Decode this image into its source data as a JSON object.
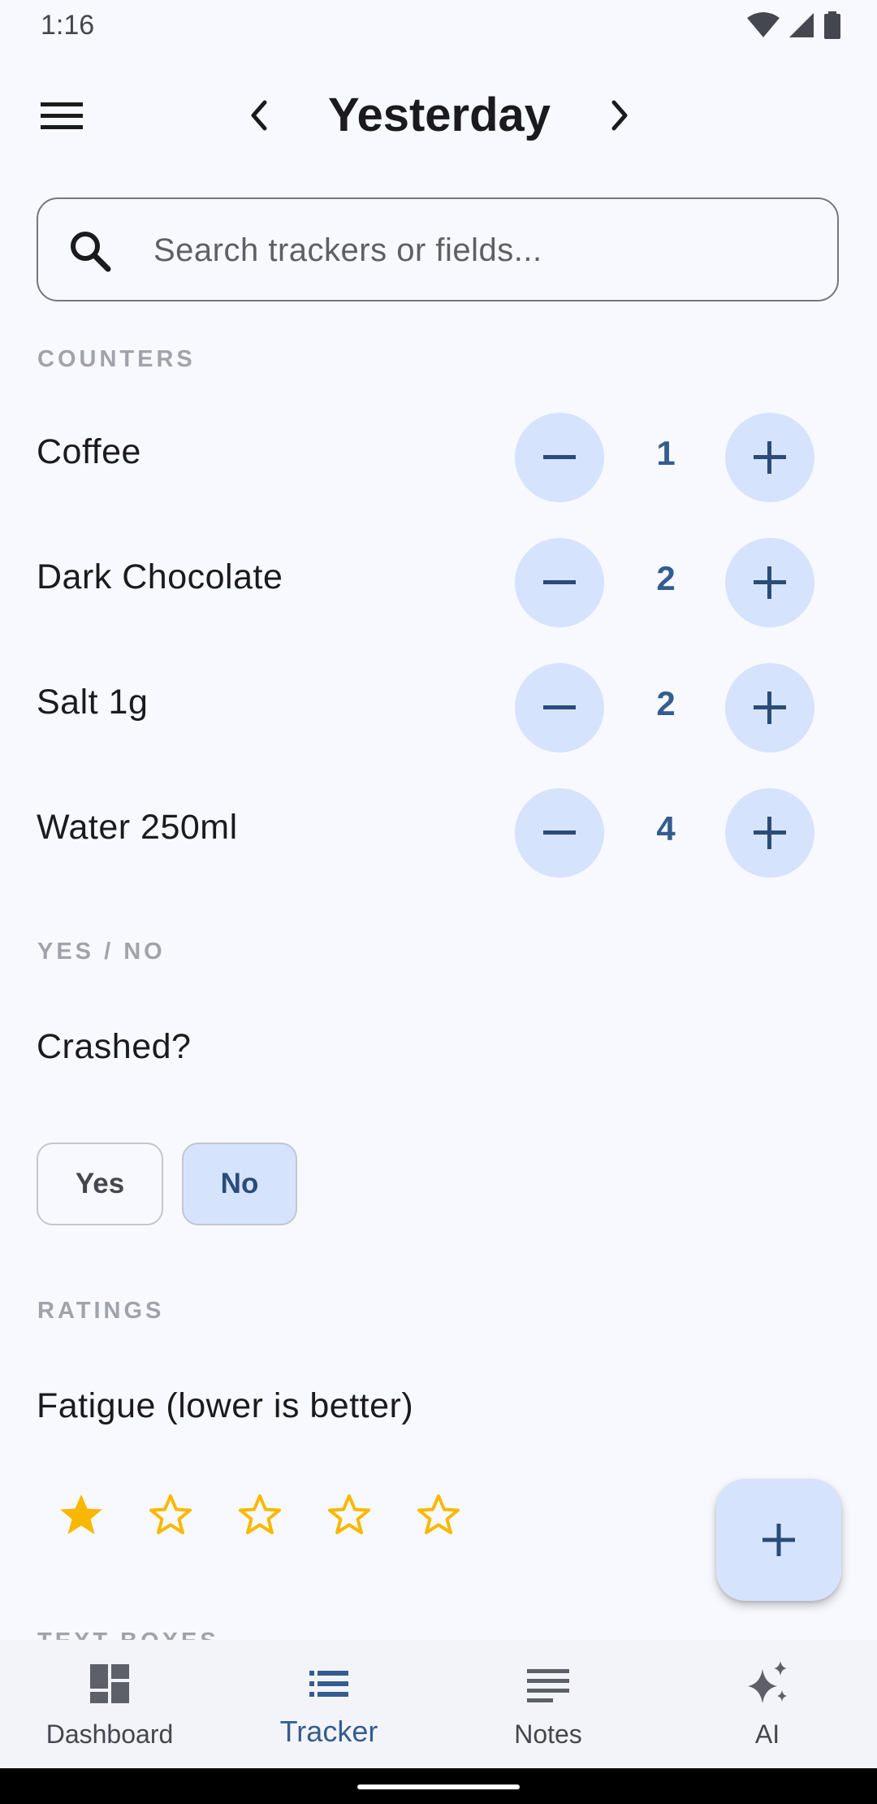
{
  "status_bar": {
    "time": "1:16"
  },
  "header": {
    "title": "Yesterday"
  },
  "search": {
    "placeholder": "Search trackers or fields..."
  },
  "sections": {
    "counters": "COUNTERS",
    "yes_no": "YES / NO",
    "ratings": "RATINGS",
    "text_boxes": "TEXT BOXES"
  },
  "counters": [
    {
      "label": "Coffee",
      "value": "1"
    },
    {
      "label": "Dark Chocolate",
      "value": "2"
    },
    {
      "label": "Salt 1g",
      "value": "2"
    },
    {
      "label": "Water 250ml",
      "value": "4"
    }
  ],
  "yes_no": {
    "question": "Crashed?",
    "yes_label": "Yes",
    "no_label": "No",
    "selected": "No"
  },
  "rating": {
    "label": "Fatigue (lower is better)",
    "value": 1,
    "max": 5
  },
  "bottom_nav": [
    {
      "label": "Dashboard",
      "icon": "dashboard-icon",
      "active": false
    },
    {
      "label": "Tracker",
      "icon": "list-icon",
      "active": true
    },
    {
      "label": "Notes",
      "icon": "notes-icon",
      "active": false
    },
    {
      "label": "AI",
      "icon": "sparkle-icon",
      "active": false
    }
  ],
  "colors": {
    "accent": "#345d8f",
    "accent_container": "#d6e3fd",
    "star": "#f9b800",
    "background": "#f8f9fe"
  }
}
